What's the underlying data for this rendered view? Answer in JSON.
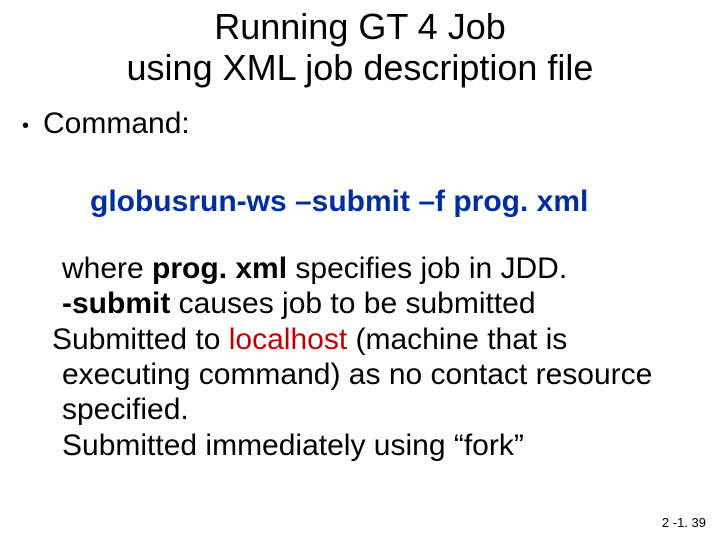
{
  "title_line1": "Running GT 4 Job",
  "title_line2": "using XML job description file",
  "bullet_label": "Command:",
  "command_text": "globusrun-ws –submit –f prog. xml",
  "body": {
    "l1_a": "where ",
    "l1_b": "prog. xml",
    "l1_c": "  specifies job in JDD.",
    "l2_a": "-submit",
    "l2_b": " causes job to be submitted",
    "l3_a": "Submitted to ",
    "l3_b": "localhost",
    "l3_c": " (machine that is",
    "l4": "executing command) as no contact resource",
    "l5": "specified.",
    "l6": "Submitted immediately using “fork”"
  },
  "page_number": "2 -1. 39"
}
